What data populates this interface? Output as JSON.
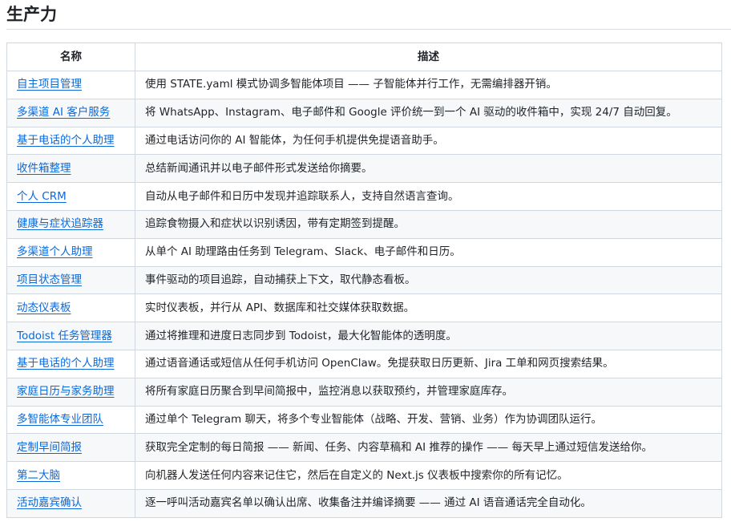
{
  "heading": "生产力",
  "table": {
    "headers": [
      "名称",
      "描述"
    ],
    "rows": [
      {
        "name": "自主项目管理",
        "desc": "使用 STATE.yaml 模式协调多智能体项目 —— 子智能体并行工作，无需编排器开销。"
      },
      {
        "name": "多渠道 AI 客户服务",
        "desc": "将 WhatsApp、Instagram、电子邮件和 Google 评价统一到一个 AI 驱动的收件箱中，实现 24/7 自动回复。"
      },
      {
        "name": "基于电话的个人助理",
        "desc": "通过电话访问你的 AI 智能体，为任何手机提供免提语音助手。"
      },
      {
        "name": "收件箱整理",
        "desc": "总结新闻通讯并以电子邮件形式发送给你摘要。"
      },
      {
        "name": "个人 CRM",
        "desc": "自动从电子邮件和日历中发现并追踪联系人，支持自然语言查询。"
      },
      {
        "name": "健康与症状追踪器",
        "desc": "追踪食物摄入和症状以识别诱因，带有定期签到提醒。"
      },
      {
        "name": "多渠道个人助理",
        "desc": "从单个 AI 助理路由任务到 Telegram、Slack、电子邮件和日历。"
      },
      {
        "name": "项目状态管理",
        "desc": "事件驱动的项目追踪，自动捕获上下文，取代静态看板。"
      },
      {
        "name": "动态仪表板",
        "desc": "实时仪表板，并行从 API、数据库和社交媒体获取数据。"
      },
      {
        "name": "Todoist 任务管理器",
        "desc": "通过将推理和进度日志同步到 Todoist，最大化智能体的透明度。"
      },
      {
        "name": "基于电话的个人助理",
        "desc": "通过语音通话或短信从任何手机访问 OpenClaw。免提获取日历更新、Jira 工单和网页搜索结果。"
      },
      {
        "name": "家庭日历与家务助理",
        "desc": "将所有家庭日历聚合到早间简报中，监控消息以获取预约，并管理家庭库存。"
      },
      {
        "name": "多智能体专业团队",
        "desc": "通过单个 Telegram 聊天，将多个专业智能体（战略、开发、营销、业务）作为协调团队运行。"
      },
      {
        "name": "定制早间简报",
        "desc": "获取完全定制的每日简报 —— 新闻、任务、内容草稿和 AI 推荐的操作 —— 每天早上通过短信发送给你。"
      },
      {
        "name": "第二大脑",
        "desc": "向机器人发送任何内容来记住它，然后在自定义的 Next.js 仪表板中搜索你的所有记忆。"
      },
      {
        "name": "活动嘉宾确认",
        "desc": "逐一呼叫活动嘉宾名单以确认出席、收集备注并编译摘要 —— 通过 AI 语音通话完全自动化。"
      }
    ]
  }
}
